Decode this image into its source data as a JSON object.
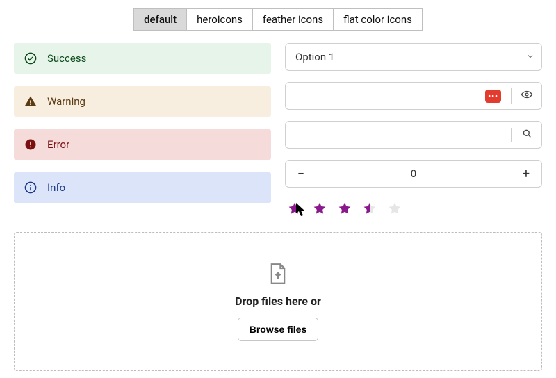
{
  "tabs": [
    {
      "label": "default",
      "active": true
    },
    {
      "label": "heroicons",
      "active": false
    },
    {
      "label": "feather icons",
      "active": false
    },
    {
      "label": "flat color icons",
      "active": false
    }
  ],
  "alerts": {
    "success": "Success",
    "warning": "Warning",
    "error": "Error",
    "info": "Info"
  },
  "select": {
    "value": "Option 1"
  },
  "password": {
    "value": "",
    "strength_badge": "•••"
  },
  "search": {
    "value": ""
  },
  "stepper": {
    "minus": "−",
    "plus": "+",
    "value": "0"
  },
  "rating": {
    "value": 3.5,
    "max": 5
  },
  "dropzone": {
    "text": "Drop files here or",
    "button": "Browse files"
  },
  "colors": {
    "star": "#8a1a8c",
    "badge": "#e33b2e"
  }
}
